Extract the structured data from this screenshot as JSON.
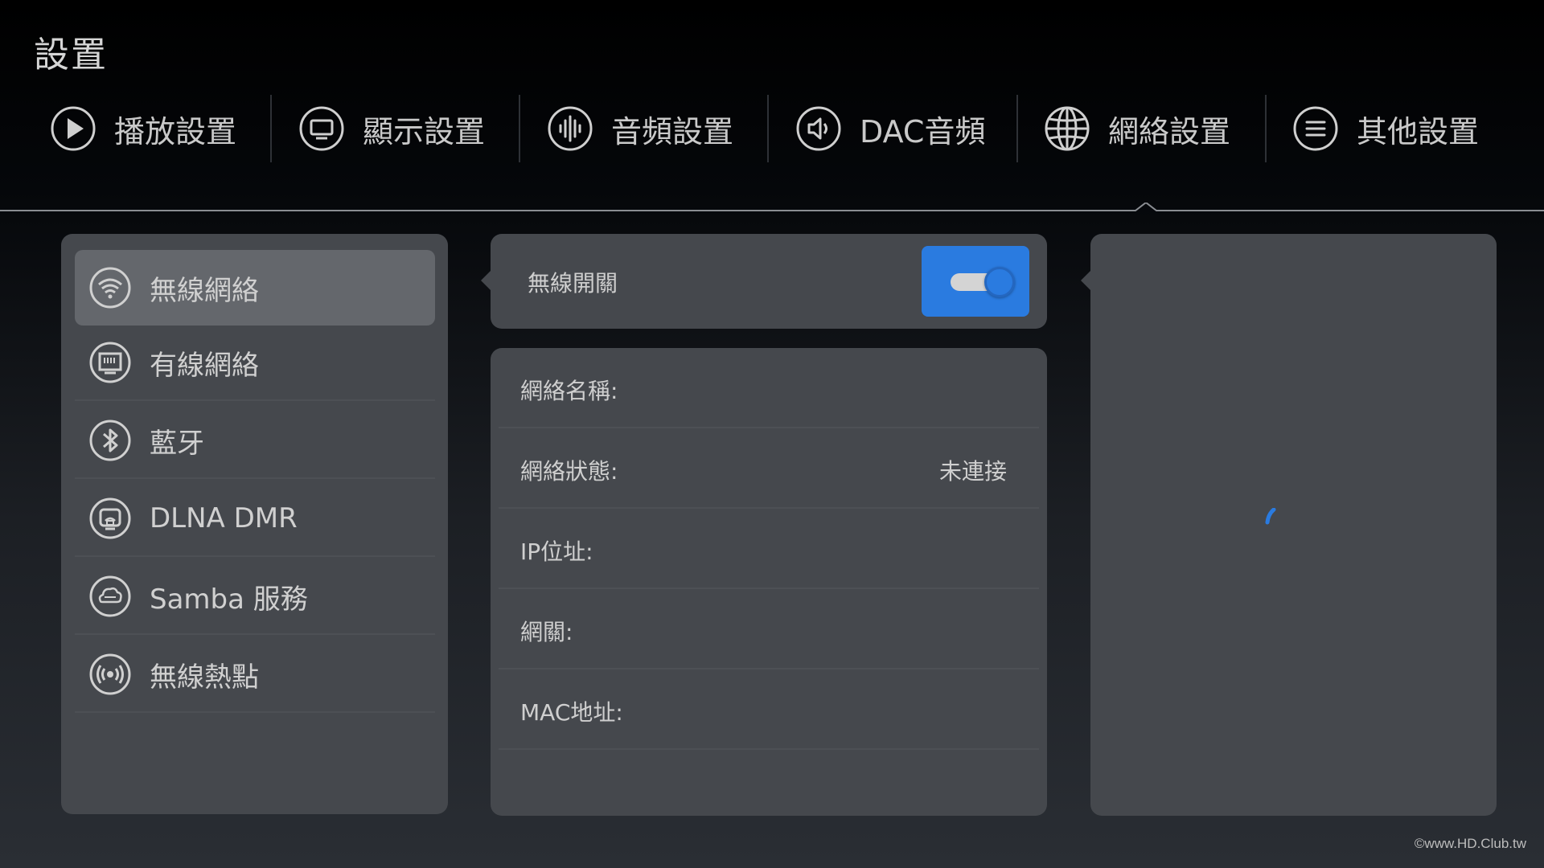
{
  "page": {
    "title": "設置"
  },
  "tabs": [
    {
      "label": "播放設置",
      "icon": "play-icon"
    },
    {
      "label": "顯示設置",
      "icon": "monitor-icon"
    },
    {
      "label": "音頻設置",
      "icon": "audio-waveform-icon"
    },
    {
      "label": "DAC音頻",
      "icon": "speaker-icon"
    },
    {
      "label": "網絡設置",
      "icon": "globe-icon",
      "selected": true
    },
    {
      "label": "其他設置",
      "icon": "menu-list-icon"
    }
  ],
  "sidebar": {
    "items": [
      {
        "label": "無線網絡",
        "icon": "wifi-icon",
        "active": true
      },
      {
        "label": "有線網絡",
        "icon": "ethernet-port-icon"
      },
      {
        "label": "藍牙",
        "icon": "bluetooth-icon"
      },
      {
        "label": "DLNA DMR",
        "icon": "dlna-cast-icon"
      },
      {
        "label": "Samba 服務",
        "icon": "samba-cloud-icon"
      },
      {
        "label": "無線熱點",
        "icon": "hotspot-icon"
      }
    ]
  },
  "wireless_switch": {
    "label": "無線開關",
    "enabled": true
  },
  "network_info": {
    "rows": [
      {
        "label": "網絡名稱:",
        "value": ""
      },
      {
        "label": "網絡狀態:",
        "value": "未連接"
      },
      {
        "label": "IP位址:",
        "value": ""
      },
      {
        "label": "網關:",
        "value": ""
      },
      {
        "label": "MAC地址:",
        "value": ""
      }
    ]
  },
  "watermark": "©www.HD.Club.tw",
  "colors": {
    "accent": "#2a7be0",
    "panel": "#45484d",
    "active_item": "#64676c",
    "text": "#cfcfcf"
  }
}
